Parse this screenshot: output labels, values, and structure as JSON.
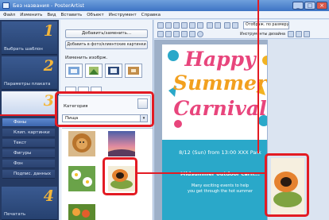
{
  "window": {
    "title": "Без названия - PosterArtist",
    "buttons": [
      "_",
      "□",
      "×"
    ]
  },
  "menu": [
    "Файл",
    "Изменить",
    "Вид",
    "Вставить",
    "Объект",
    "Инструмент",
    "Справка"
  ],
  "sidebar": {
    "steps": [
      {
        "number": "1",
        "label": "Выбрать шаблон"
      },
      {
        "number": "2",
        "label": "Параметры плаката"
      },
      {
        "number": "3",
        "label": ""
      },
      {
        "number": "4",
        "label": "Печатать"
      }
    ],
    "sub_items": [
      "Фоны",
      "Клип. картинки",
      "Текст",
      "Фигуры",
      "Фон",
      "Подпис. данных"
    ],
    "selected_sub_item": "Фоны"
  },
  "panel": {
    "add_change_button": "Добавить/заменить...",
    "add_clipart_button": "Добавить в фото/клиентские картинки",
    "change_images_label": "Изменить изобрж.",
    "category_label": "Категория",
    "category_value": "Пища",
    "category_arrow": "▾"
  },
  "toolbar": {
    "zoom_label": "Отобрaж. по размеру",
    "layout_label": "Инструменты дизайна"
  },
  "poster": {
    "title_line1": "Happy",
    "title_line2": "Summer",
    "title_line3": "Carnival",
    "date_line": "8/12 (Sun) from 13:00  XXX Park",
    "subtitle": "Midsummer outdoor carn...",
    "footer_line1": "Many exciting events to help",
    "footer_line2": "you get through the hot summer"
  },
  "colors": {
    "highlight": "#e31b23",
    "poster_bg": "#2aa8c9",
    "title_pink": "#e8457c",
    "sidebar_bg": "#253a63",
    "step_number": "#f4b63a"
  }
}
